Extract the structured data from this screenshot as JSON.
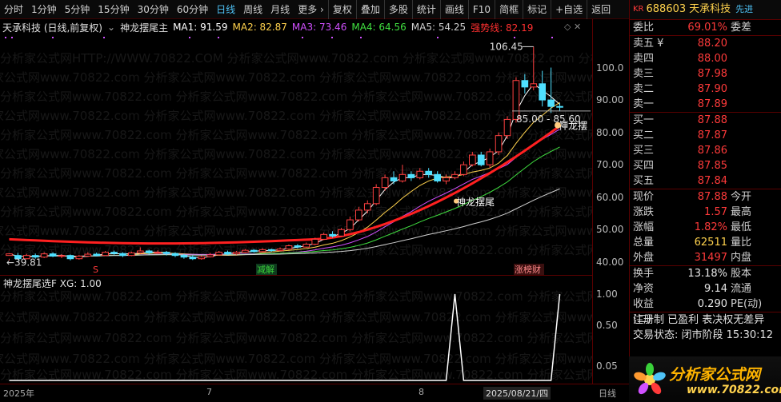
{
  "toolbar": {
    "periods": [
      "分时",
      "1分钟",
      "5分钟",
      "15分钟",
      "30分钟",
      "60分钟",
      "日线",
      "周线",
      "月线",
      "更多 ›"
    ],
    "active_period": "日线",
    "tools": [
      "复权",
      "叠加",
      "多股",
      "统计",
      "画线",
      "F10",
      "简框",
      "标记",
      "+自选",
      "返回"
    ]
  },
  "chart_header": {
    "stock": "天承科技 (日线,前复权)",
    "indicator": "神龙摆尾主",
    "ma1": "MA1: 91.59",
    "ma2": "MA2: 82.87",
    "ma3": "MA3: 73.46",
    "ma4": "MA4: 64.56",
    "ma5": "MA5: 54.25",
    "strong": "强势线: 82.19"
  },
  "chart_labels": {
    "high": "106.45",
    "low": "39.81",
    "range": "85.00 - 85.60",
    "tag1": "神龙摆",
    "tag2": "神龙摆尾",
    "mark_s": "S",
    "mark_reduce": "减解",
    "mark_limit": "涨榜财",
    "watermark_top": "分析家公式网HTTP://WWW.70822.COM",
    "watermark": "分析家公式网www.70822.com"
  },
  "sub_header": "神龙摆尾选F  XG: 1.00",
  "price_axis": [
    "100.0",
    "90.00",
    "80.00",
    "70.00",
    "60.00",
    "50.00",
    "40.00"
  ],
  "sub_axis": [
    "1.00",
    "0.50",
    "0.05"
  ],
  "time_axis": [
    "2025年",
    "7",
    "8",
    "2025/08/21/四",
    "日线"
  ],
  "chart_data": {
    "type": "candlestick",
    "ylim": [
      36,
      110
    ],
    "candles": [
      [
        42,
        42.5,
        41,
        40.5
      ],
      [
        42,
        41,
        42.8,
        40.6
      ],
      [
        41,
        42,
        42.5,
        40.8
      ],
      [
        42,
        41.5,
        42.6,
        41
      ],
      [
        41.5,
        42.5,
        43,
        41.2
      ],
      [
        42.5,
        41.8,
        43,
        41.5
      ],
      [
        41.8,
        42,
        42.4,
        41.2
      ],
      [
        42,
        41,
        42.3,
        40.5
      ],
      [
        41,
        41.8,
        42.2,
        40.7
      ],
      [
        41.8,
        42.4,
        43,
        41.6
      ],
      [
        42.4,
        42,
        42.9,
        41.7
      ],
      [
        42,
        43,
        43.4,
        41.8
      ],
      [
        43,
        42.6,
        43.5,
        42.2
      ],
      [
        42.6,
        42,
        43,
        41.5
      ],
      [
        42,
        42.8,
        43.2,
        41.8
      ],
      [
        42.8,
        43.4,
        44.5,
        42.5
      ],
      [
        43.4,
        42.8,
        43.8,
        42.3
      ],
      [
        42.8,
        43,
        43.6,
        42.5
      ],
      [
        43,
        42.6,
        43.4,
        42
      ],
      [
        42.6,
        42,
        43,
        41.5
      ],
      [
        42,
        41.5,
        42.5,
        41
      ],
      [
        41.5,
        41,
        42,
        40.6
      ],
      [
        41,
        41.6,
        42,
        40.7
      ],
      [
        41.6,
        42.2,
        42.8,
        41.4
      ],
      [
        42.2,
        43,
        43.4,
        42
      ],
      [
        43,
        42.5,
        43.5,
        42.1
      ],
      [
        42.5,
        43,
        43.4,
        42.2
      ],
      [
        43,
        43.6,
        44,
        42.8
      ],
      [
        43.6,
        43.2,
        44,
        42.9
      ],
      [
        43.2,
        43.8,
        44.2,
        43
      ],
      [
        43.8,
        43.5,
        44.1,
        43.1
      ],
      [
        43.5,
        44,
        44.5,
        43.3
      ],
      [
        44,
        45,
        45.4,
        43.8
      ],
      [
        45,
        44.6,
        45.5,
        44.2
      ],
      [
        44.6,
        45.5,
        46,
        44.4
      ],
      [
        45.5,
        47,
        47.5,
        45.2
      ],
      [
        47,
        48.5,
        49,
        46.8
      ],
      [
        48.5,
        48,
        49.5,
        47.5
      ],
      [
        48,
        50,
        50.5,
        47.8
      ],
      [
        50,
        53,
        54,
        49.5
      ],
      [
        53,
        56,
        57,
        52.5
      ],
      [
        56,
        58,
        59,
        55
      ],
      [
        58,
        63,
        64,
        57.5
      ],
      [
        63,
        66,
        67,
        62
      ],
      [
        66,
        65,
        68,
        64
      ],
      [
        65,
        67,
        70,
        64.5
      ],
      [
        67,
        66,
        68,
        65
      ],
      [
        66,
        68,
        69,
        65.5
      ],
      [
        68,
        67,
        69,
        66
      ],
      [
        67,
        65,
        68,
        64.5
      ],
      [
        65,
        66,
        67,
        64
      ],
      [
        66,
        67,
        68,
        65.5
      ],
      [
        67,
        70,
        71,
        66.5
      ],
      [
        70,
        73,
        74,
        69.5
      ],
      [
        73,
        70,
        74,
        69.5
      ],
      [
        70,
        74,
        75,
        69
      ],
      [
        74,
        79,
        80,
        73
      ],
      [
        79,
        84,
        85,
        78
      ],
      [
        84,
        96,
        97,
        83
      ],
      [
        96,
        94,
        98,
        92
      ],
      [
        94,
        95,
        106.45,
        93
      ],
      [
        95,
        90,
        99,
        88
      ],
      [
        90,
        88,
        100,
        86
      ],
      [
        88,
        87.88,
        89,
        86.5
      ]
    ],
    "series": [
      {
        "name": "MA1",
        "values": []
      },
      {
        "name": "MA2",
        "values": []
      },
      {
        "name": "MA3",
        "values": []
      },
      {
        "name": "MA4",
        "values": []
      },
      {
        "name": "MA5",
        "values": []
      },
      {
        "name": "强势线",
        "values": []
      }
    ],
    "xg": [
      0,
      0,
      0,
      0,
      0,
      0,
      0,
      0,
      0,
      0,
      0,
      0,
      0,
      0,
      0,
      0,
      0,
      0,
      0,
      0,
      0,
      0,
      0,
      0,
      0,
      0,
      0,
      0,
      0,
      0,
      0,
      0,
      0,
      0,
      0,
      0,
      0,
      0,
      0,
      0,
      0,
      0,
      0,
      0,
      0,
      0,
      0,
      0,
      0,
      0,
      0,
      1,
      0,
      0,
      0,
      0,
      0,
      0,
      0,
      0,
      0,
      0,
      0,
      1
    ]
  },
  "panel": {
    "code": "688603",
    "name": "天承科技",
    "prefix": "KR",
    "flag": "先进",
    "weibi_label": "委比",
    "weibi": "69.01%",
    "weicha_label": "委差",
    "asks": [
      {
        "label": "卖五 ¥",
        "price": "88.20"
      },
      {
        "label": "卖四",
        "price": "88.00"
      },
      {
        "label": "卖三",
        "price": "87.98"
      },
      {
        "label": "卖二",
        "price": "87.90"
      },
      {
        "label": "卖一",
        "price": "87.89"
      }
    ],
    "bids": [
      {
        "label": "买一",
        "price": "87.88"
      },
      {
        "label": "买二",
        "price": "87.87"
      },
      {
        "label": "买三",
        "price": "87.86"
      },
      {
        "label": "买四",
        "price": "87.85"
      },
      {
        "label": "买五",
        "price": "87.84"
      }
    ],
    "quote": [
      {
        "label": "现价",
        "value": "87.88",
        "label2": "今开",
        "color": "red"
      },
      {
        "label": "涨跌",
        "value": "1.57",
        "label2": "最高",
        "color": "red"
      },
      {
        "label": "涨幅",
        "value": "1.82%",
        "label2": "最低",
        "color": "red"
      },
      {
        "label": "总量",
        "value": "62511",
        "label2": "量比",
        "color": "yellow"
      },
      {
        "label": "外盘",
        "value": "31497",
        "label2": "内盘",
        "color": "red"
      }
    ],
    "stats": [
      {
        "label": "换手",
        "value": "13.18%",
        "label2": "股本"
      },
      {
        "label": "净资",
        "value": "9.14",
        "label2": "流通"
      },
      {
        "label": "收益(二)",
        "value": "0.290",
        "label2": "PE(动)"
      }
    ],
    "reg": "注册制  已盈利  表决权无差异",
    "status": "交易状态: 闭市阶段 15:30:12",
    "logo_text": "分析家公式网",
    "logo_url": "www.70822.com"
  }
}
